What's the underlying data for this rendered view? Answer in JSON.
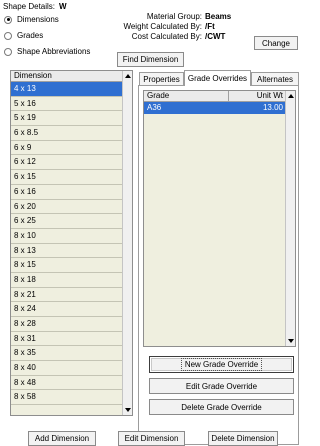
{
  "shape_details": {
    "label": "Shape Details:",
    "value": "W"
  },
  "radio_options": [
    {
      "label": "Dimensions",
      "selected": true
    },
    {
      "label": "Grades",
      "selected": false
    },
    {
      "label": "Shape Abbreviations",
      "selected": false
    }
  ],
  "info": {
    "material_group_label": "Material Group:",
    "material_group_value": "Beams",
    "weight_label": "Weight Calculated By:",
    "weight_value": "/Ft",
    "cost_label": "Cost Calculated By:",
    "cost_value": "/CWT"
  },
  "buttons": {
    "change": "Change",
    "find_dimension": "Find Dimension",
    "new_grade_override": "New Grade Override",
    "edit_grade_override": "Edit Grade Override",
    "delete_grade_override": "Delete Grade Override",
    "add_dimension": "Add Dimension",
    "edit_dimension": "Edit Dimension",
    "delete_dimension": "Delete Dimension"
  },
  "dimension_list": {
    "header": "Dimension",
    "items": [
      "4 x 13",
      "5 x 16",
      "5 x 19",
      "6 x 8.5",
      "6 x 9",
      "6 x 12",
      "6 x 15",
      "6 x 16",
      "6 x 20",
      "6 x 25",
      "8 x 10",
      "8 x 13",
      "8 x 15",
      "8 x 18",
      "8 x 21",
      "8 x 24",
      "8 x 28",
      "8 x 31",
      "8 x 35",
      "8 x 40",
      "8 x 48",
      "8 x 58"
    ],
    "selected_index": 0
  },
  "tabs": [
    {
      "label": "Properties",
      "active": false
    },
    {
      "label": "Grade Overrides",
      "active": true
    },
    {
      "label": "Alternates",
      "active": false
    }
  ],
  "grade_overrides": {
    "columns": [
      "Grade",
      "Unit Wt"
    ],
    "rows": [
      {
        "grade": "A36",
        "unit_wt": "13.00"
      }
    ]
  },
  "colors": {
    "selection": "#2f6fd1",
    "list_background": "#efefdf"
  }
}
